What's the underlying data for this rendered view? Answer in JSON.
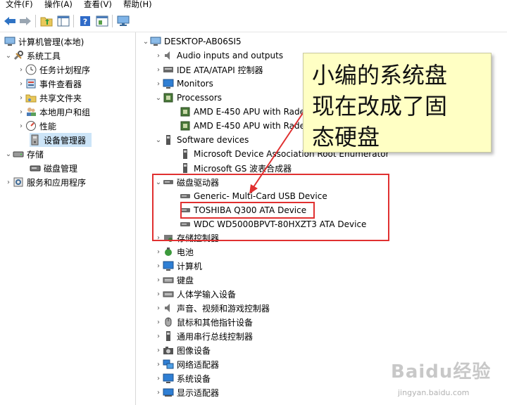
{
  "menubar": {
    "items": [
      "文件(F)",
      "操作(A)",
      "查看(V)",
      "帮助(H)"
    ]
  },
  "toolbar": {
    "buttons": [
      {
        "name": "back-icon"
      },
      {
        "name": "forward-icon"
      },
      {
        "name": "up-folder-icon"
      },
      {
        "name": "show-hide-tree-icon"
      },
      {
        "name": "help-icon"
      },
      {
        "name": "properties-icon"
      },
      {
        "name": "monitor-icon"
      }
    ]
  },
  "left_tree": {
    "root": "计算机管理(本地)",
    "system_tools": "系统工具",
    "task_scheduler": "任务计划程序",
    "event_viewer": "事件查看器",
    "shared_folders": "共享文件夹",
    "local_users": "本地用户和组",
    "performance": "性能",
    "device_manager": "设备管理器",
    "storage": "存储",
    "disk_management": "磁盘管理",
    "services_apps": "服务和应用程序"
  },
  "device_tree": {
    "computer": "DESKTOP-AB06SI5",
    "audio": "Audio inputs and outputs",
    "ide": "IDE ATA/ATAPI 控制器",
    "monitors": "Monitors",
    "processors": "Processors",
    "cpu1": "AMD E-450 APU with Radeon(tm) HD Graphics",
    "cpu2": "AMD E-450 APU with Radeon(tm) HD Graphics",
    "software_devices": "Software devices",
    "sw1": "Microsoft Device Association Root Enumerator",
    "sw2": "Microsoft GS 波表合成器",
    "disk_drives": "磁盘驱动器",
    "disk1": "Generic- Multi-Card USB Device",
    "disk2": "TOSHIBA Q300 ATA Device",
    "disk3": "WDC WD5000BPVT-80HXZT3 ATA Device",
    "storage_ctrl": "存储控制器",
    "battery": "电池",
    "computer_cat": "计算机",
    "keyboard": "键盘",
    "hid": "人体学输入设备",
    "sound": "声音、视频和游戏控制器",
    "mouse": "鼠标和其他指针设备",
    "usb": "通用串行总线控制器",
    "imaging": "图像设备",
    "network": "网络适配器",
    "system": "系统设备",
    "display": "显示适配器"
  },
  "annotation": {
    "line1": "小编的系统盘",
    "line2": "现在改成了固",
    "line3": "态硬盘"
  },
  "watermark": {
    "brand": "Baidu经验",
    "url": "jingyan.baidu.com"
  },
  "colors": {
    "selection": "#cce4f7",
    "note_bg": "#ffffc4",
    "highlight": "#e03030",
    "tree_chevron": "#555555"
  }
}
